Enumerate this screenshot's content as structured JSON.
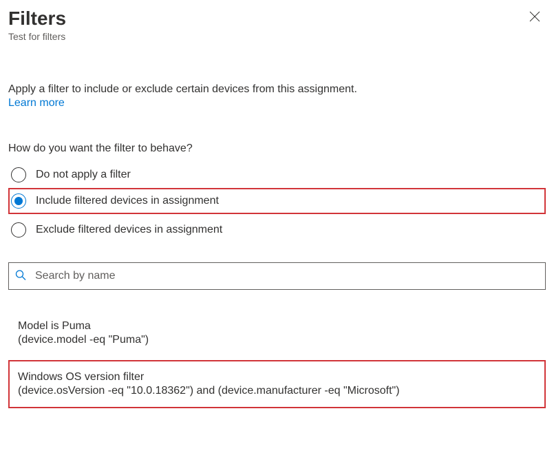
{
  "header": {
    "title": "Filters",
    "subtitle": "Test for filters"
  },
  "intro": {
    "text": "Apply a filter to include or exclude certain devices from this assignment.",
    "learn_more": "Learn more"
  },
  "question": "How do you want the filter to behave?",
  "options": {
    "none": "Do not apply a filter",
    "include": "Include filtered devices in assignment",
    "exclude": "Exclude filtered devices in assignment",
    "selected": "include"
  },
  "search": {
    "placeholder": "Search by name",
    "value": ""
  },
  "filters": [
    {
      "name": "Model is Puma",
      "rule": "(device.model -eq \"Puma\")",
      "highlighted": false
    },
    {
      "name": "Windows OS version filter",
      "rule": "(device.osVersion -eq \"10.0.18362\") and (device.manufacturer -eq \"Microsoft\")",
      "highlighted": true
    }
  ],
  "colors": {
    "highlight_border": "#d13438",
    "accent": "#0078d4"
  }
}
